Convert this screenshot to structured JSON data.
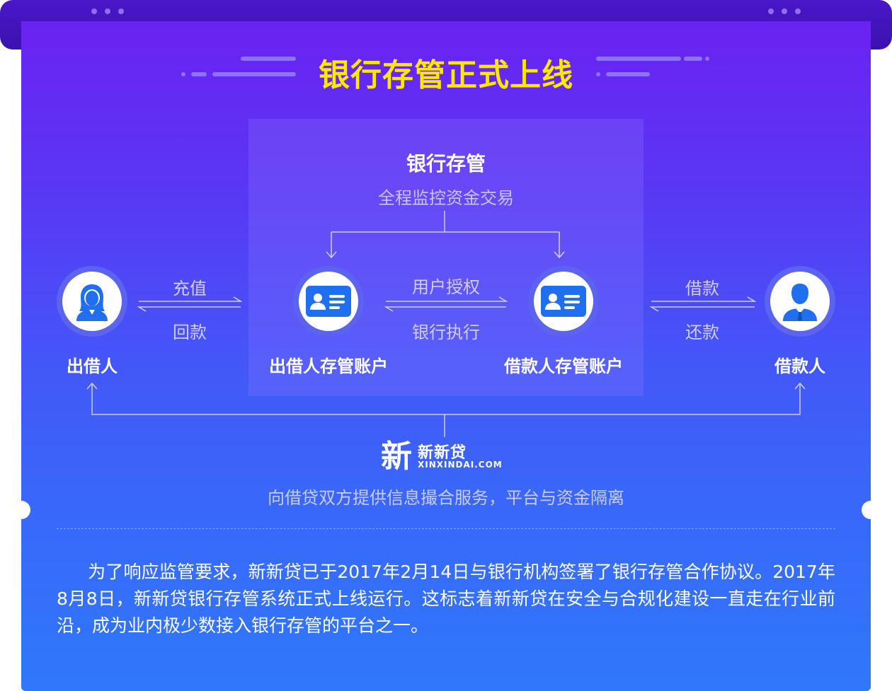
{
  "colors": {
    "headline": "#ffe800",
    "panel_top": "#6a22f2",
    "panel_bottom": "#2f78fb",
    "icon_blue": "#1f6ff0",
    "avatar_ring": "#5c63ee"
  },
  "headline": "银行存管正式上线",
  "bank": {
    "title": "银行存管",
    "subtitle": "全程监控资金交易"
  },
  "nodes": {
    "lender": {
      "label": "出借人",
      "icon": "female-user-icon"
    },
    "lender_account": {
      "label": "出借人存管账户",
      "icon": "id-card-icon"
    },
    "borrower_account": {
      "label": "借款人存管账户",
      "icon": "id-card-icon"
    },
    "borrower": {
      "label": "借款人",
      "icon": "male-user-icon"
    }
  },
  "flows": {
    "recharge": "充值",
    "repay_to_lender": "回款",
    "authorize": "用户授权",
    "bank_execute": "银行执行",
    "loan": "借款",
    "repay": "还款"
  },
  "platform": {
    "logo_char": "新",
    "name": "新新贷",
    "domain": "XINXINDAI.COM",
    "slogan": "向借贷双方提供信息撮合服务，平台与资金隔离"
  },
  "paragraph": "为了响应监管要求，新新贷已于2017年2月14日与银行机构签署了银行存管合作协议。2017年8月8日，新新贷银行存管系统正式上线运行。这标志着新新贷在安全与合规化建设一直走在行业前沿，成为业内极少数接入银行存管的平台之一。"
}
